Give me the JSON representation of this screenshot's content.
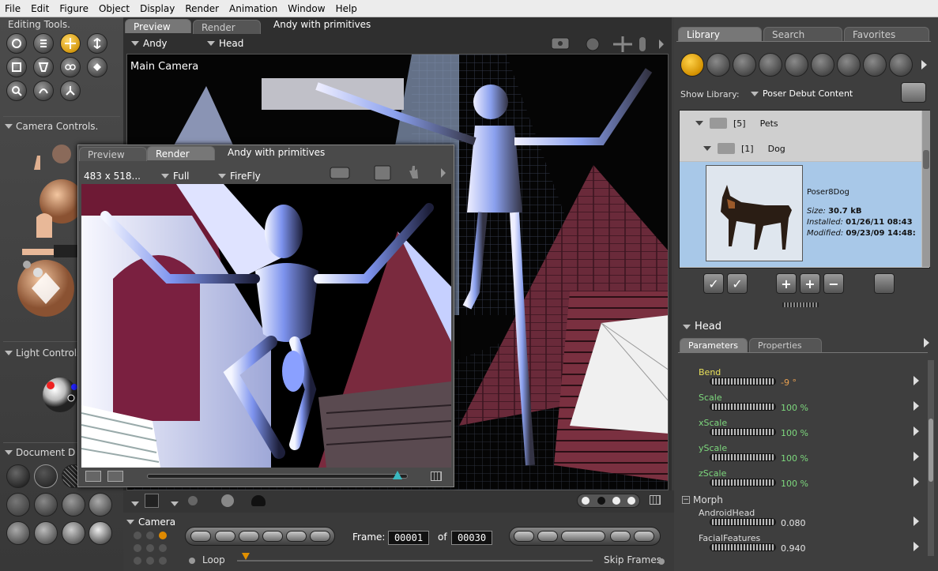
{
  "menu": [
    "File",
    "Edit",
    "Figure",
    "Object",
    "Display",
    "Render",
    "Animation",
    "Window",
    "Help"
  ],
  "left": {
    "editing_title": "Editing Tools.",
    "camera_title": "Camera Controls.",
    "light_title": "Light Controls",
    "document_title": "Document D",
    "camera_label": "Camera"
  },
  "main": {
    "tab_preview": "Preview",
    "tab_render": "Render",
    "title": "Andy with primitives",
    "figure_select": "Andy",
    "part_select": "Head",
    "camera_name": "Main Camera"
  },
  "render_window": {
    "tab_preview": "Preview",
    "tab_render": "Render",
    "title": "Andy with primitives",
    "size_text": "483 x 518...",
    "quality_select": "Full",
    "engine_select": "FireFly"
  },
  "timeline": {
    "frame_label": "Frame:",
    "frame_value": "00001",
    "of_label": "of",
    "total_value": "00030",
    "loop_label": "Loop",
    "skip_label": "Skip Frames"
  },
  "library": {
    "tabs": [
      "Library",
      "Search",
      "Favorites"
    ],
    "show_label": "Show Library:",
    "show_value": "Poser Debut Content",
    "folder1_count": "[5]",
    "folder1_name": "Pets",
    "folder2_count": "[1]",
    "folder2_name": "Dog",
    "item_name": "Poser8Dog",
    "size_label": "Size:",
    "size_value": "30.7 kB",
    "installed_label": "Installed:",
    "installed_value": "01/26/11 08:43",
    "modified_label": "Modified:",
    "modified_value": "09/23/09 14:48:"
  },
  "params": {
    "actor": "Head",
    "tab_parameters": "Parameters",
    "tab_properties": "Properties",
    "items": [
      {
        "label": "Bend",
        "value": "-9 °"
      },
      {
        "label": "Scale",
        "value": "100 %"
      },
      {
        "label": "xScale",
        "value": "100 %"
      },
      {
        "label": "yScale",
        "value": "100 %"
      },
      {
        "label": "zScale",
        "value": "100 %"
      }
    ],
    "morph_group": "Morph",
    "morphs": [
      {
        "label": "AndroidHead",
        "value": "0.080"
      },
      {
        "label": "FacialFeatures",
        "value": "0.940"
      }
    ]
  },
  "colors": {
    "accent": "#f0a800",
    "param_label": "#7dd87d",
    "bend_label": "#e8e05a",
    "selection": "#a8c8e8"
  }
}
